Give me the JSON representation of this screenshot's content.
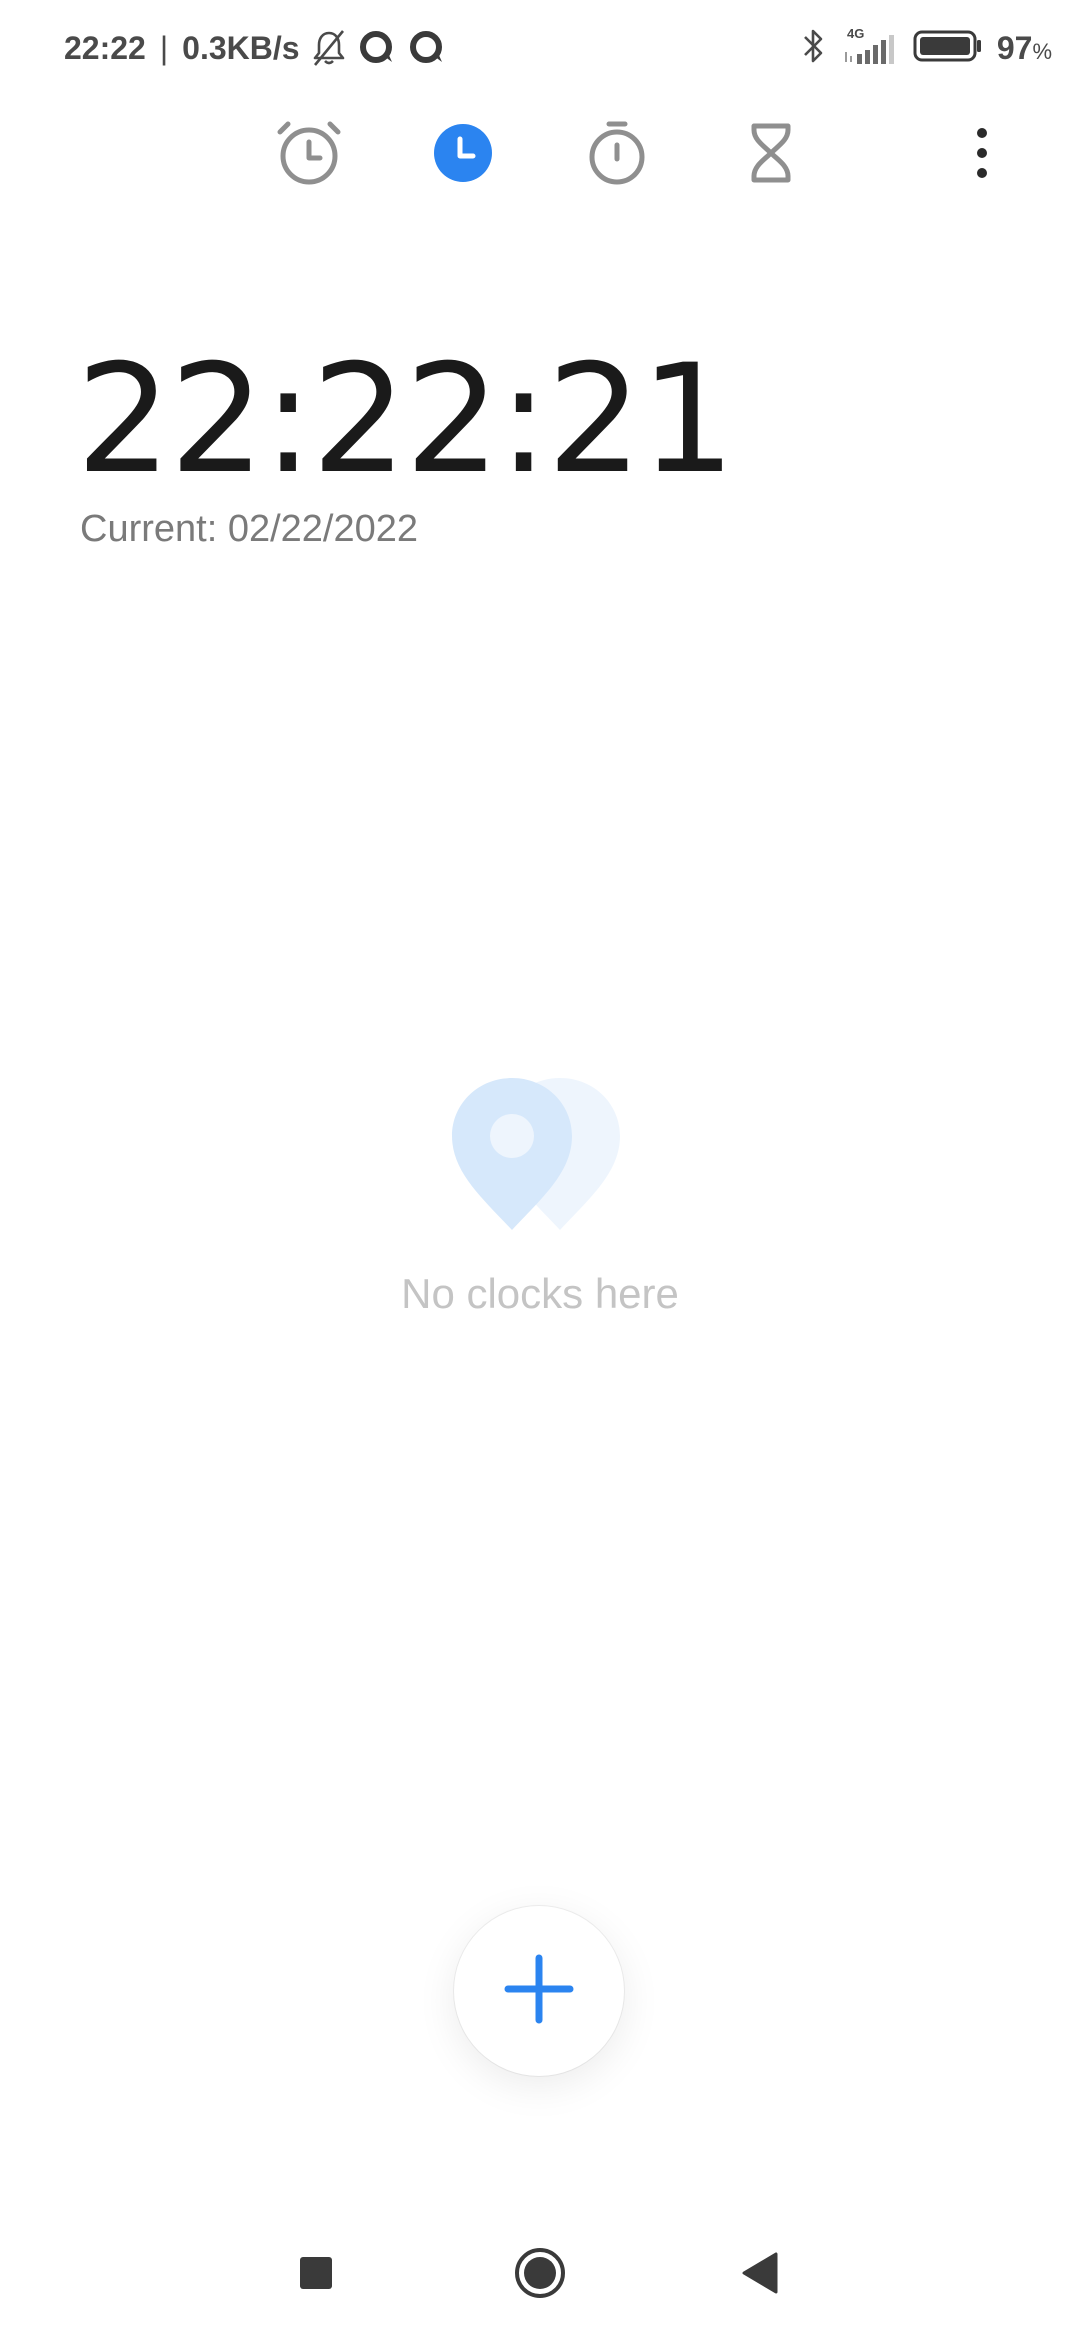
{
  "status_bar": {
    "time": "22:22",
    "separator": "|",
    "network_speed": "0.3KB/s",
    "left_icons": [
      "bell-off-icon",
      "chat-bubble-icon",
      "chat-bubble-icon"
    ],
    "right_icons": [
      "bluetooth-icon",
      "signal-4g-icon",
      "battery-icon"
    ],
    "network_type": "4G",
    "battery_level": "97",
    "battery_unit": "%"
  },
  "tabs": [
    {
      "id": "alarm",
      "icon": "alarm-clock-icon",
      "active": false
    },
    {
      "id": "clock",
      "icon": "clock-icon",
      "active": true
    },
    {
      "id": "stopwatch",
      "icon": "stopwatch-icon",
      "active": false
    },
    {
      "id": "timer",
      "icon": "hourglass-icon",
      "active": false
    }
  ],
  "more_menu_icon": "more-vertical-icon",
  "clock": {
    "time": "22:22:21",
    "current_date": "Current: 02/22/2022"
  },
  "empty_state": {
    "icon": "location-pin-icon",
    "message": "No clocks here"
  },
  "fab": {
    "icon": "plus-icon"
  },
  "nav": {
    "recents_icon": "square-icon",
    "home_icon": "circle-icon",
    "back_icon": "triangle-back-icon"
  },
  "colors": {
    "accent": "#2b84f0",
    "icon_gray": "#8f8f8f",
    "text_primary": "#1a1a1a",
    "text_secondary": "#7a7a7a",
    "empty_text": "#c4c4c4",
    "pin_light": "#d6e8fb",
    "pin_lighter": "#eef5fd"
  }
}
